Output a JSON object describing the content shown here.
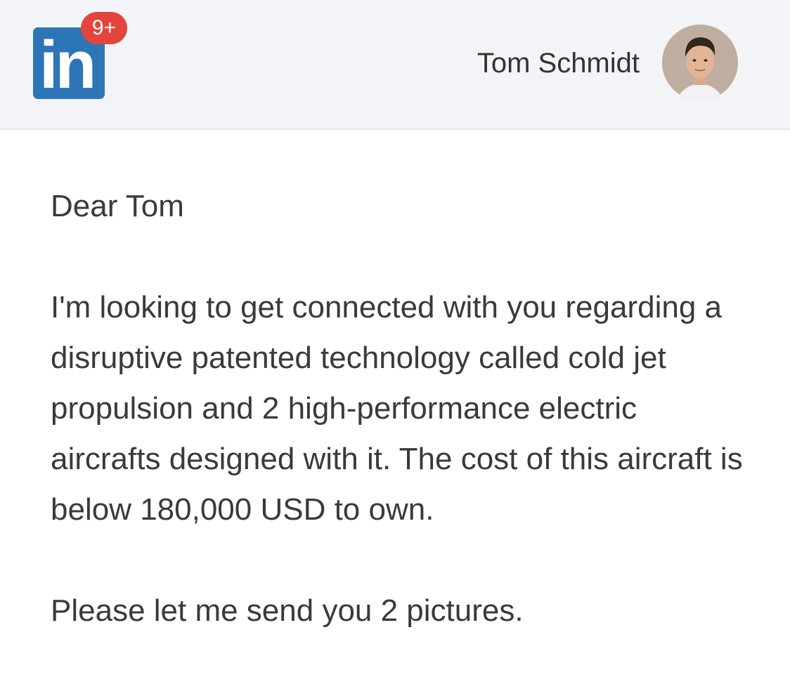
{
  "header": {
    "logo_text": "in",
    "notification_badge": "9+",
    "user_name": "Tom Schmidt",
    "avatar_icon": "user-avatar-photo"
  },
  "message": {
    "greeting": "Dear Tom",
    "body": "I'm looking to get connected with you regarding a disruptive patented technology called cold jet propulsion and 2 high-performance electric aircrafts designed with it. The cost of this aircraft is below 180,000 USD to own.",
    "closing": "Please let me send you 2 pictures."
  },
  "colors": {
    "brand": "#2c76b8",
    "badge": "#e2453c",
    "header_bg": "#f3f4f7",
    "text": "#3a3a3a"
  }
}
